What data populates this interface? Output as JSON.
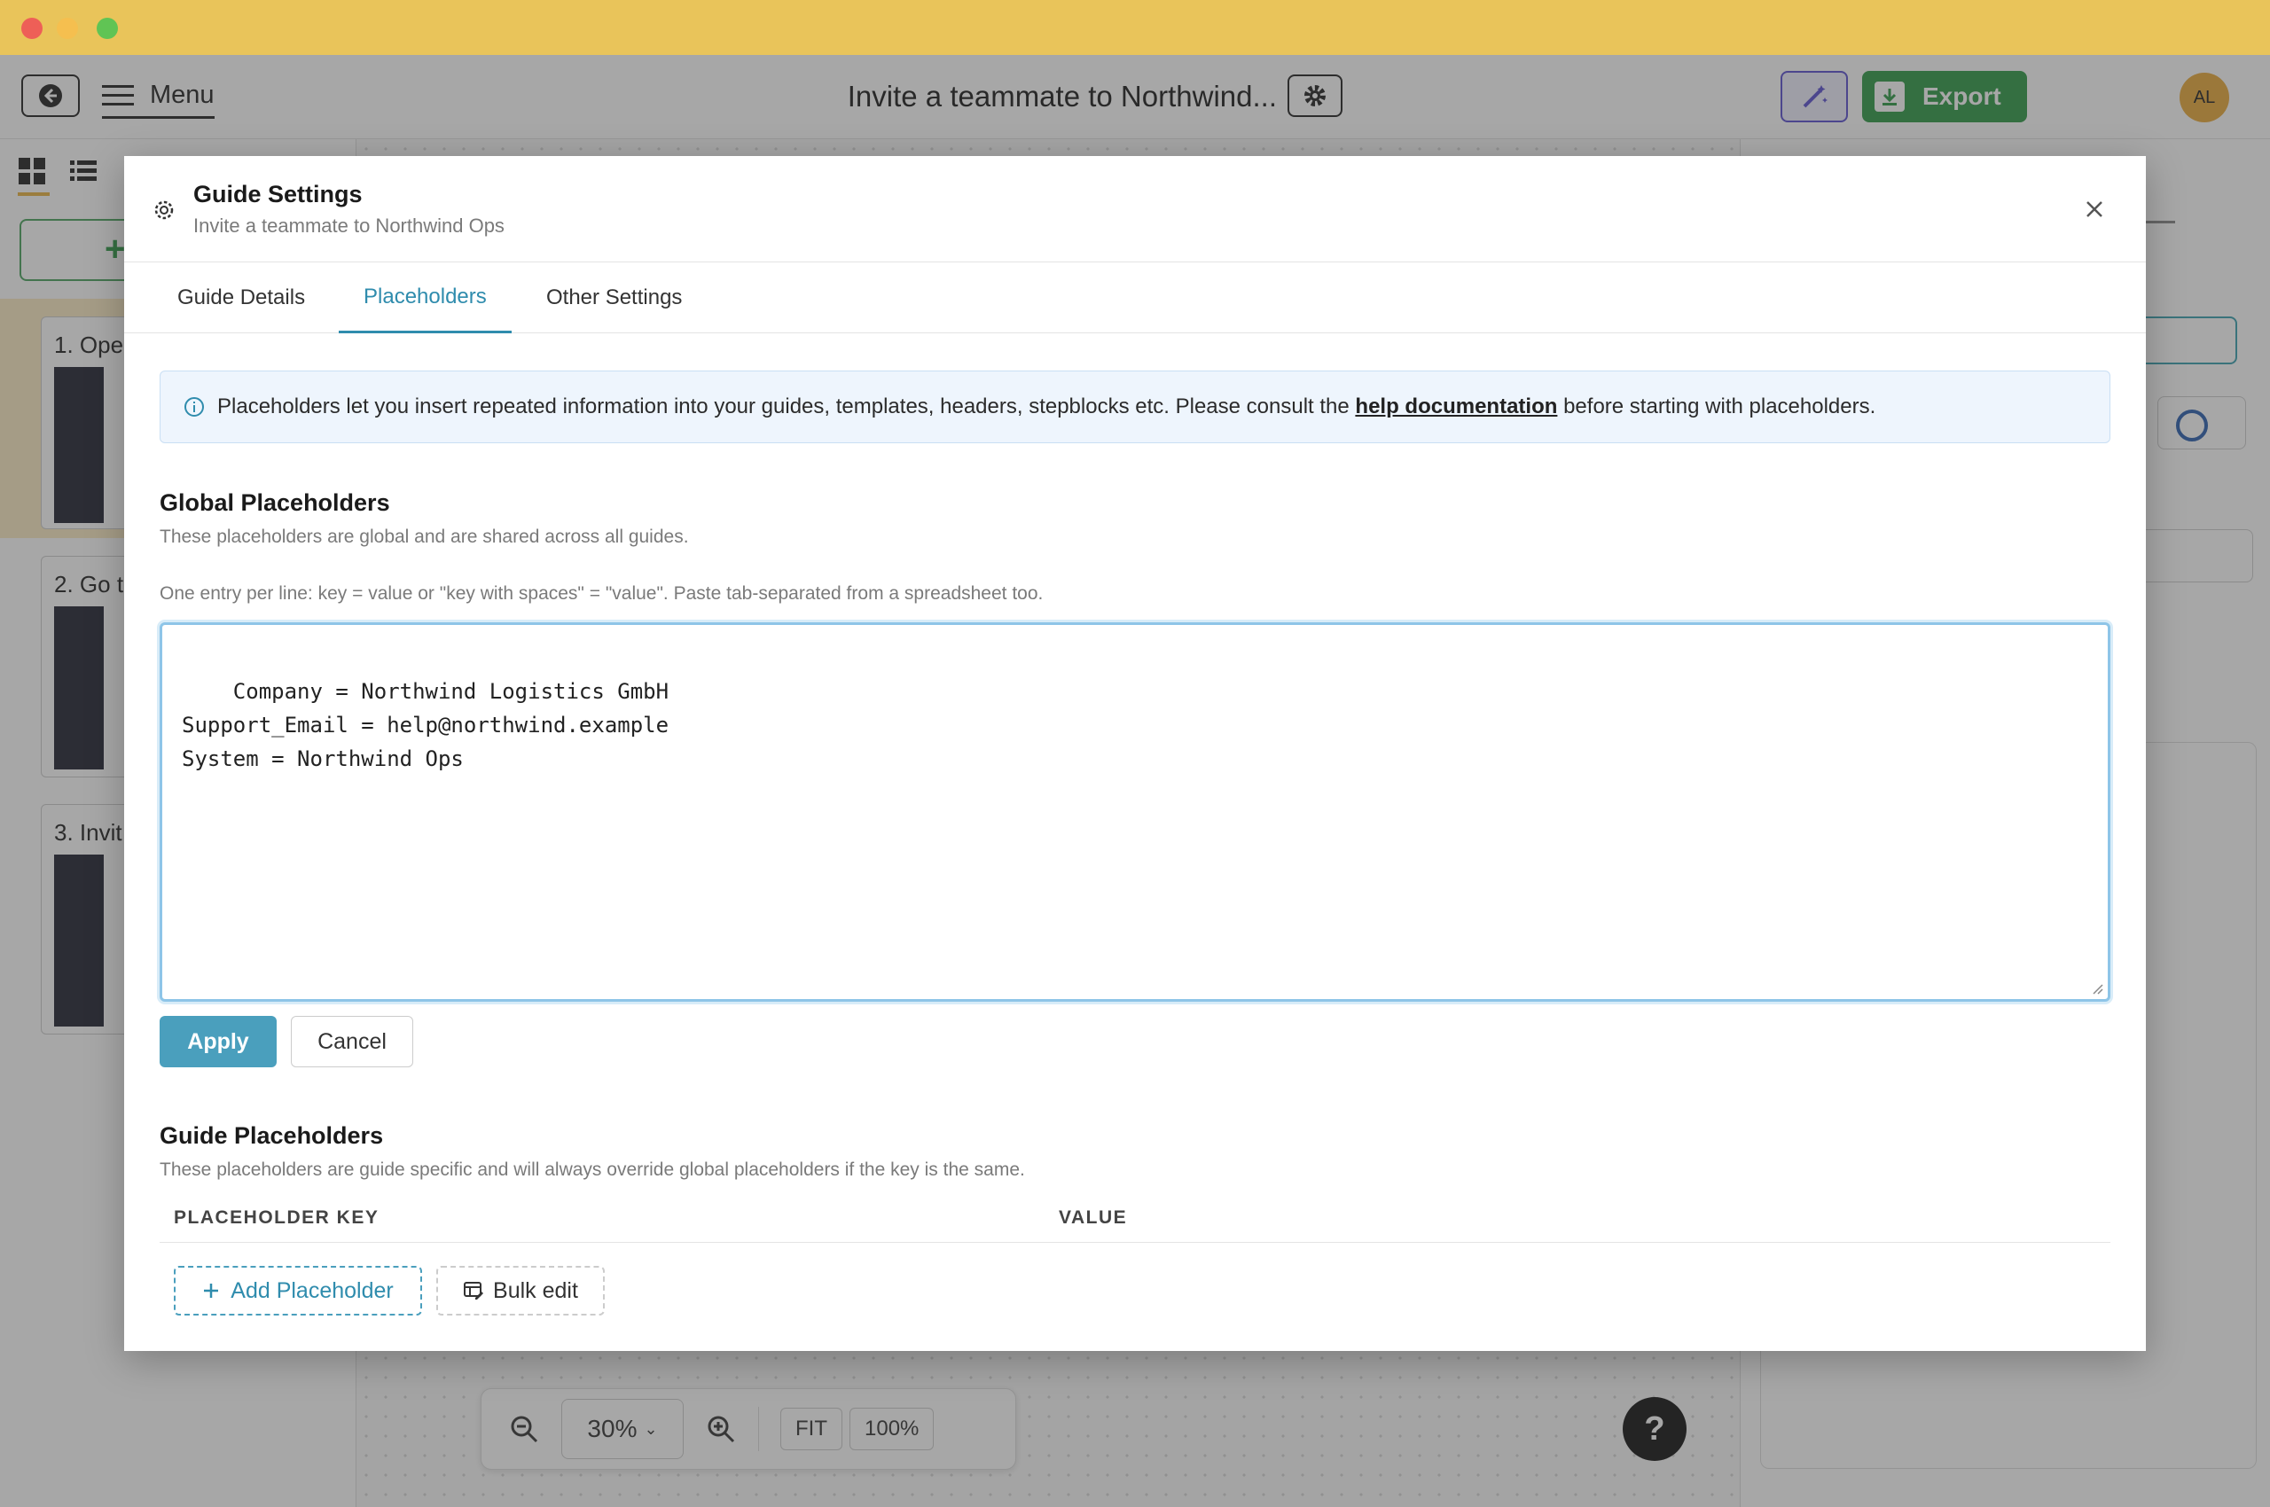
{
  "app": {
    "doc_title": "Invite a teammate to Northwind...",
    "menu_label": "Menu",
    "export_label": "Export",
    "avatar_initials": "AL"
  },
  "steps": [
    {
      "label": "1. Oper"
    },
    {
      "label": "2. Go t"
    },
    {
      "label": "3. Invit"
    }
  ],
  "zoom": {
    "level": "30%",
    "fit_label": "FIT",
    "full_label": "100%"
  },
  "help_label": "?",
  "modal": {
    "title": "Guide Settings",
    "subtitle": "Invite a teammate to Northwind Ops",
    "tabs": [
      {
        "label": "Guide Details"
      },
      {
        "label": "Placeholders"
      },
      {
        "label": "Other Settings"
      }
    ],
    "info": {
      "text_before": "Placeholders let you insert repeated information into your guides, templates, headers, stepblocks etc. Please consult the",
      "link": "help documentation",
      "text_after": "before starting with placeholders."
    },
    "global": {
      "title": "Global Placeholders",
      "subtitle": "These placeholders are global and are shared across all guides.",
      "hint": "One entry per line: key = value or \"key with spaces\" = \"value\". Paste tab-separated from a spreadsheet too.",
      "textarea_value": "Company = Northwind Logistics GmbH\nSupport_Email = help@northwind.example\nSystem = Northwind Ops",
      "apply_label": "Apply",
      "cancel_label": "Cancel"
    },
    "guide": {
      "title": "Guide Placeholders",
      "subtitle": "These placeholders are guide specific and will always override global placeholders if the key is the same.",
      "col_key": "PLACEHOLDER KEY",
      "col_value": "VALUE",
      "add_label": "Add Placeholder",
      "bulk_label": "Bulk edit"
    }
  },
  "colors": {
    "titlebar": "#e9c45a",
    "accent": "#2f8cad",
    "export": "#2e9a46"
  }
}
